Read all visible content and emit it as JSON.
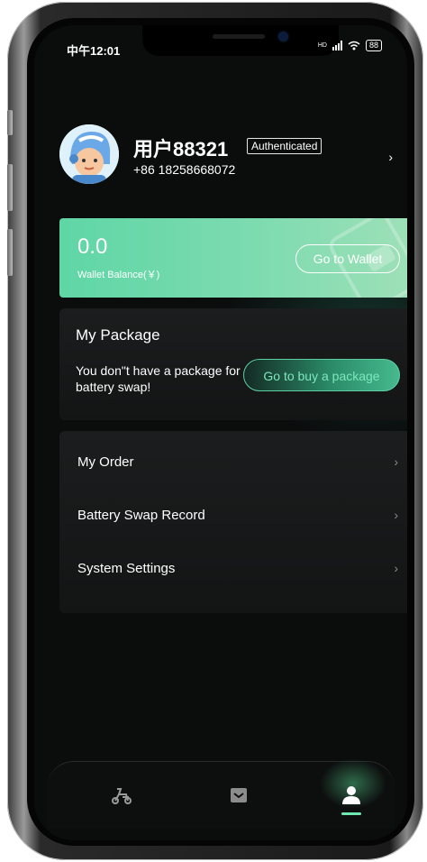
{
  "status_bar": {
    "time": "中午12:01",
    "network": "HD",
    "battery": "88"
  },
  "profile": {
    "username": "用户88321",
    "badge": "Authenticated",
    "phone": "+86 18258668072",
    "avatar_icon": "user-avatar-helmet"
  },
  "wallet": {
    "balance": "0.0",
    "label": "Wallet Balance(￥)",
    "button": "Go to Wallet"
  },
  "package": {
    "title": "My Package",
    "description": "You don\"t have a package for battery swap!",
    "button": "Go to buy a package"
  },
  "menu": {
    "items": [
      {
        "label": "My Order"
      },
      {
        "label": "Battery Swap Record"
      },
      {
        "label": "System Settings"
      }
    ]
  },
  "tabbar": {
    "tabs": [
      {
        "icon": "scooter-icon",
        "active": false
      },
      {
        "icon": "package-icon",
        "active": false
      },
      {
        "icon": "user-icon",
        "active": true
      }
    ],
    "accent": "#6ee7b0"
  },
  "colors": {
    "background": "#0b0d0d",
    "wallet_gradient_start": "#5fd6a6",
    "wallet_gradient_end": "#9fe0b8",
    "accent": "#5cd0a3"
  }
}
